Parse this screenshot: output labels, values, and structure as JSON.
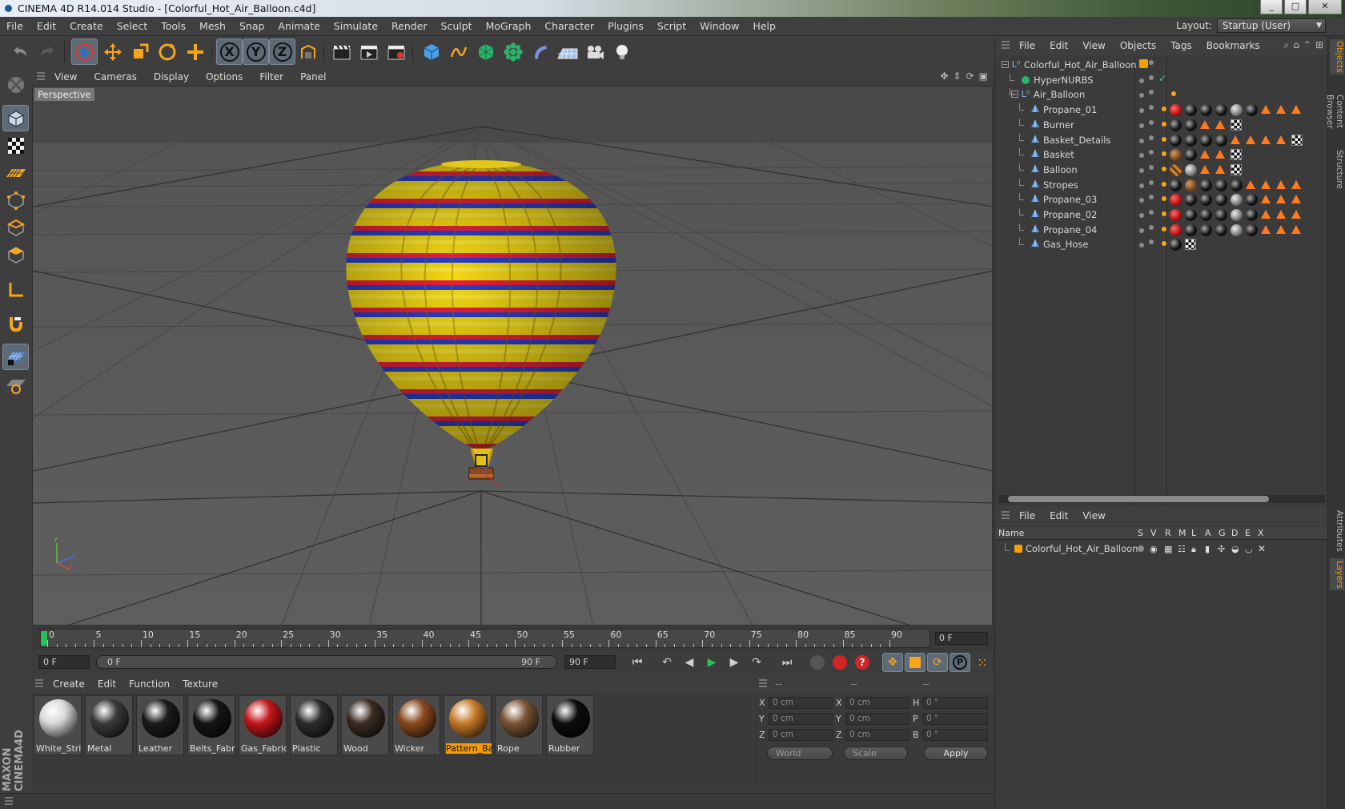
{
  "window": {
    "title": "CINEMA 4D R14.014 Studio - [Colorful_Hot_Air_Balloon.c4d]",
    "minimize": "_",
    "maximize": "□",
    "close": "✕"
  },
  "main_menu": [
    "File",
    "Edit",
    "Create",
    "Select",
    "Tools",
    "Mesh",
    "Snap",
    "Animate",
    "Simulate",
    "Render",
    "Sculpt",
    "MoGraph",
    "Character",
    "Plugins",
    "Script",
    "Window",
    "Help"
  ],
  "layout": {
    "label": "Layout:",
    "value": "Startup (User)"
  },
  "toolbar": {
    "axis_x": "X",
    "axis_y": "Y",
    "axis_z": "Z"
  },
  "viewport": {
    "menu": [
      "View",
      "Cameras",
      "Display",
      "Options",
      "Filter",
      "Panel"
    ],
    "camera_label": "Perspective",
    "axis_labels": {
      "y": "Y",
      "z": "Z",
      "x": "X"
    }
  },
  "timeline": {
    "ticks": [
      "0",
      "5",
      "10",
      "15",
      "20",
      "25",
      "30",
      "35",
      "40",
      "45",
      "50",
      "55",
      "60",
      "65",
      "70",
      "75",
      "80",
      "85",
      "90"
    ],
    "frame_display": "0 F",
    "range_start": "0 F",
    "range_slider_start": "0 F",
    "range_slider_end": "90 F",
    "range_end": "90 F"
  },
  "materials": {
    "menu": [
      "Create",
      "Edit",
      "Function",
      "Texture"
    ],
    "items": [
      {
        "label": "White_Strip",
        "color": "#d8d8d8",
        "selected": false
      },
      {
        "label": "Metal",
        "color": "#3a3a3a",
        "selected": false
      },
      {
        "label": "Leather",
        "color": "#1c1c1c",
        "selected": false
      },
      {
        "label": "Belts_Fabri",
        "color": "#151515",
        "selected": false
      },
      {
        "label": "Gas_Fabric",
        "color": "#c3151a",
        "selected": false
      },
      {
        "label": "Plastic",
        "color": "#2d2d2d",
        "selected": false
      },
      {
        "label": "Wood",
        "color": "#3a2c22",
        "selected": false
      },
      {
        "label": "Wicker",
        "color": "#8a4a1e",
        "selected": false
      },
      {
        "label": "Pattern_Ba",
        "color": "#c77a2a",
        "selected": true
      },
      {
        "label": "Rope",
        "color": "#7a5535",
        "selected": false
      },
      {
        "label": "Rubber",
        "color": "#0d0d0d",
        "selected": false
      }
    ]
  },
  "coordinates": {
    "headers": [
      "--",
      "--",
      "--"
    ],
    "rows": [
      {
        "l1": "X",
        "v1": "0 cm",
        "l2": "X",
        "v2": "0 cm",
        "l3": "H",
        "v3": "0 °"
      },
      {
        "l1": "Y",
        "v1": "0 cm",
        "l2": "Y",
        "v2": "0 cm",
        "l3": "P",
        "v3": "0 °"
      },
      {
        "l1": "Z",
        "v1": "0 cm",
        "l2": "Z",
        "v2": "0 cm",
        "l3": "B",
        "v3": "0 °"
      }
    ],
    "mode": "World",
    "transform": "Scale",
    "apply": "Apply"
  },
  "object_manager": {
    "menu": [
      "File",
      "Edit",
      "View",
      "Objects",
      "Tags",
      "Bookmarks"
    ],
    "objects": [
      {
        "name": "Colorful_Hot_Air_Balloon",
        "level": 0,
        "type": "null"
      },
      {
        "name": "HyperNURBS",
        "level": 1,
        "type": "nurbs"
      },
      {
        "name": "Air_Balloon",
        "level": 1,
        "type": "null"
      },
      {
        "name": "Propane_01",
        "level": 2,
        "type": "poly"
      },
      {
        "name": "Burner",
        "level": 2,
        "type": "poly"
      },
      {
        "name": "Basket_Details",
        "level": 2,
        "type": "poly"
      },
      {
        "name": "Basket",
        "level": 2,
        "type": "poly"
      },
      {
        "name": "Balloon",
        "level": 2,
        "type": "poly"
      },
      {
        "name": "Stropes",
        "level": 2,
        "type": "poly"
      },
      {
        "name": "Propane_03",
        "level": 2,
        "type": "poly"
      },
      {
        "name": "Propane_02",
        "level": 2,
        "type": "poly"
      },
      {
        "name": "Propane_04",
        "level": 2,
        "type": "poly"
      },
      {
        "name": "Gas_Hose",
        "level": 2,
        "type": "poly"
      }
    ]
  },
  "layer_manager": {
    "menu": [
      "File",
      "Edit",
      "View"
    ],
    "columns": [
      "Name",
      "S",
      "V",
      "R",
      "M",
      "L",
      "A",
      "G",
      "D",
      "E",
      "X"
    ],
    "layers": [
      {
        "name": "Colorful_Hot_Air_Balloon",
        "color": "#f5a000"
      }
    ]
  },
  "side_tabs": [
    "Objects",
    "Content Browser",
    "Structure",
    "Attributes",
    "Layers"
  ],
  "brand": "MAXON CINEMA4D"
}
